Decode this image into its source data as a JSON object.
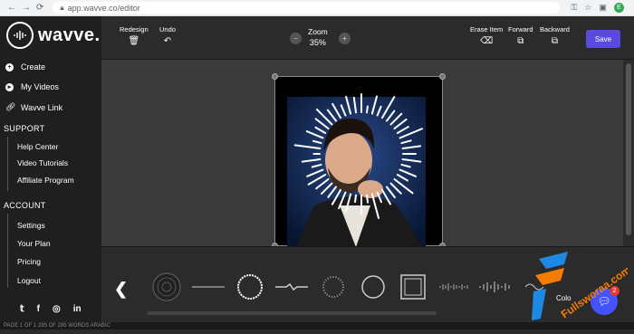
{
  "browser": {
    "url": "app.wavve.co/editor",
    "profile_initial": "E"
  },
  "logo": {
    "name": "wavve."
  },
  "sidebar": {
    "main_items": [
      {
        "label": "Create",
        "icon": "plus-icon"
      },
      {
        "label": "My Videos",
        "icon": "play-icon"
      },
      {
        "label": "Wavve Link",
        "icon": "link-icon"
      }
    ],
    "support_title": "SUPPORT",
    "support_items": [
      "Help Center",
      "Video Tutorials",
      "Affiliate Program"
    ],
    "account_title": "ACCOUNT",
    "account_items": [
      "Settings",
      "Your Plan",
      "Pricing",
      "Logout"
    ],
    "social": [
      "twitter-icon",
      "facebook-icon",
      "instagram-icon",
      "linkedin-icon"
    ]
  },
  "toolbar": {
    "redesign": "Redesign",
    "undo": "Undo",
    "zoom_label": "Zoom",
    "zoom_value": "35%",
    "erase": "Erase Item",
    "forward": "Forward",
    "backward": "Backward",
    "save": "Save"
  },
  "bottom": {
    "color_label": "Colo",
    "chat_badge": "2"
  },
  "watermark": "Fullsworaa.com",
  "statusbar": "PAGE 1 OF 1   295 OF 295 WORDS   ARABIC"
}
